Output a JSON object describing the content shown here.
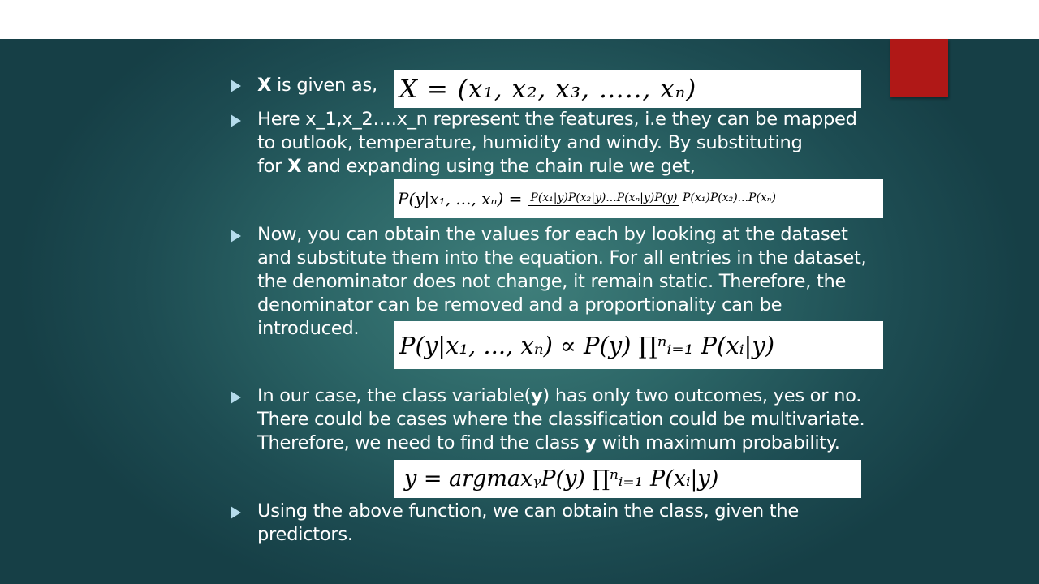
{
  "slide": {
    "bullets": [
      {
        "pre": "",
        "bold": "X",
        "post": " is given as,",
        "equation": "X = (x₁, x₂, x₃, ….., xₙ)"
      },
      {
        "line1": "Here x_1,x_2….x_n represent the features, i.e they can be mapped",
        "line2": "to outlook, temperature, humidity and windy. By substituting",
        "line3_pre": "for ",
        "line3_bold": "X",
        "line3_post": " and expanding using the chain rule we get,",
        "equation_lhs": "P(y|x₁, ..., xₙ) =",
        "equation_num": "P(x₁|y)P(x₂|y)...P(xₙ|y)P(y)",
        "equation_den": "P(x₁)P(x₂)...P(xₙ)"
      },
      {
        "line1": "Now, you can obtain the values for each by looking at the dataset",
        "line2": "and substitute them into the equation. For all entries in the dataset,",
        "line3": "the denominator does not change, it remain static. Therefore, the",
        "line4": "denominator can be removed and a proportionality can be",
        "line5": "introduced.",
        "equation": "P(y|x₁, ..., xₙ) ∝ P(y) ∏ⁿᵢ₌₁ P(xᵢ|y)"
      },
      {
        "line1_pre": "In our case, the class variable(",
        "line1_bold": "y",
        "line1_post": ") has only two outcomes, yes or no.",
        "line2": "There could be cases where the classification could be multivariate.",
        "line3_pre": "Therefore, we need to find the class ",
        "line3_bold": "y",
        "line3_post": " with maximum probability.",
        "equation": "y = argmaxᵧP(y) ∏ⁿᵢ₌₁ P(xᵢ|y)"
      },
      {
        "line1": "Using the above function, we can obtain the class, given the",
        "line2": "predictors."
      }
    ]
  },
  "colors": {
    "background": "#2c6667",
    "accent_square": "#b01817",
    "bullet": "#b5dcec",
    "text": "#ffffff"
  }
}
